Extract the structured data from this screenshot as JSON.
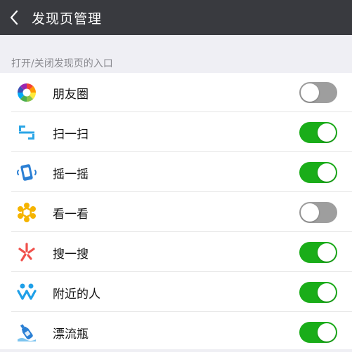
{
  "header": {
    "title": "发现页管理"
  },
  "section": {
    "label": "打开/关闭发现页的入口"
  },
  "items": [
    {
      "label": "朋友圈",
      "icon": "moments-icon",
      "enabled": false
    },
    {
      "label": "扫一扫",
      "icon": "scan-icon",
      "enabled": true
    },
    {
      "label": "摇一摇",
      "icon": "shake-icon",
      "enabled": true
    },
    {
      "label": "看一看",
      "icon": "top-stories-icon",
      "enabled": false
    },
    {
      "label": "搜一搜",
      "icon": "search-icon",
      "enabled": true
    },
    {
      "label": "附近的人",
      "icon": "people-nearby-icon",
      "enabled": true
    },
    {
      "label": "漂流瓶",
      "icon": "drift-bottle-icon",
      "enabled": true
    }
  ],
  "colors": {
    "header_bg": "#393a3f",
    "toggle_on": "#1aad19",
    "toggle_off": "#9e9e9e",
    "background": "#efeff4"
  }
}
